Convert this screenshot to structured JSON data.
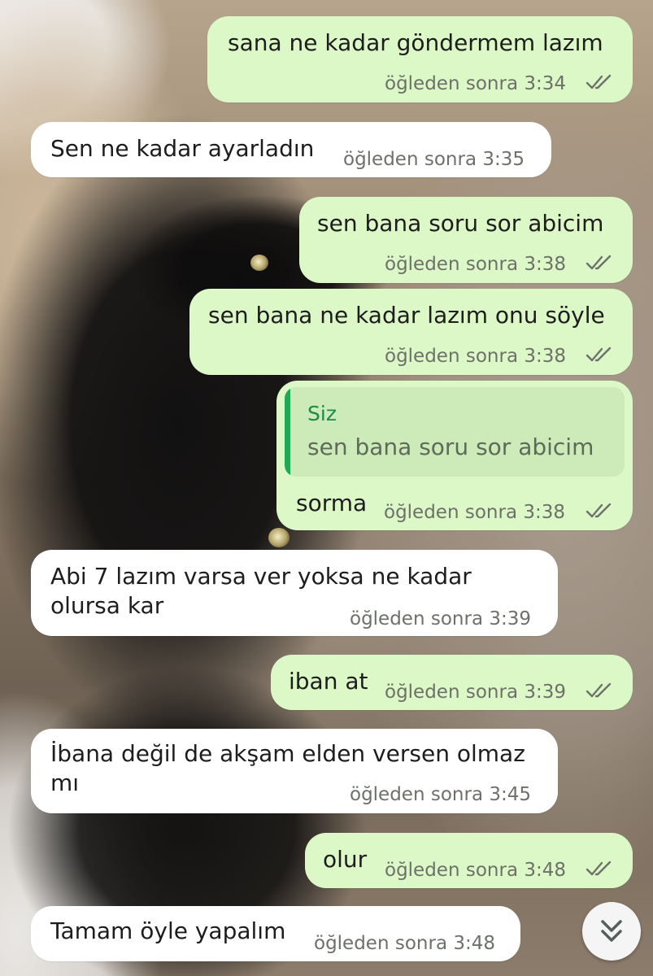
{
  "messages": [
    {
      "text": "sana ne kadar göndermem lazım",
      "time": "öğleden sonra 3:34"
    },
    {
      "text": "Sen ne kadar ayarladın",
      "time": "öğleden sonra 3:35"
    },
    {
      "text": "sen bana soru sor abicim",
      "time": "öğleden sonra 3:38"
    },
    {
      "text": "sen bana ne kadar lazım onu söyle",
      "time": "öğleden sonra 3:38"
    },
    {
      "quote_author": "Siz",
      "quote_text": "sen bana soru sor abicim",
      "text": "sorma",
      "time": "öğleden sonra 3:38"
    },
    {
      "text_line1": "Abi 7 lazım varsa ver yoksa ne kadar",
      "text_line2": "olursa kar",
      "time": "öğleden sonra 3:39"
    },
    {
      "text": "iban at",
      "time": "öğleden sonra 3:39"
    },
    {
      "text_line1": "İbana değil de akşam elden versen olmaz",
      "text_line2": "mı",
      "time": "öğleden sonra 3:45"
    },
    {
      "text": "olur",
      "time": "öğleden sonra 3:48"
    },
    {
      "text": "Tamam öyle yapalım",
      "time": "öğleden sonra 3:48"
    }
  ],
  "icons": {
    "read_receipt": "double-check-icon",
    "scroll_down": "double-chevron-down-icon"
  },
  "colors": {
    "outgoing_bubble": "#dcf8c6",
    "incoming_bubble": "#ffffff",
    "quote_bar": "#1fa855",
    "quote_author": "#1e8a4a"
  }
}
